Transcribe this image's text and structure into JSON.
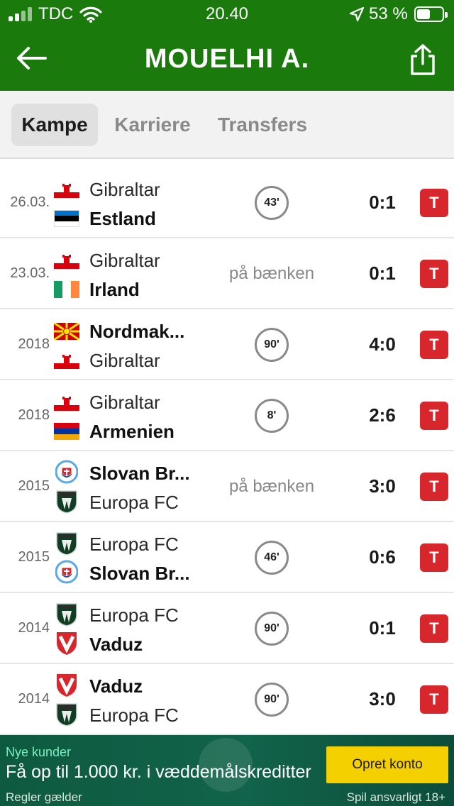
{
  "status_bar": {
    "carrier": "TDC",
    "time": "20.40",
    "battery": "53 %",
    "battery_level": 0.53,
    "icons": [
      "signal-icon",
      "wifi-icon",
      "location-arrow-icon",
      "battery-icon"
    ]
  },
  "header": {
    "title": "MOUELHI A.",
    "back_icon": "arrow-left-icon",
    "share_icon": "share-icon"
  },
  "tabs": [
    {
      "label": "Kampe",
      "active": true
    },
    {
      "label": "Karriere",
      "active": false
    },
    {
      "label": "Transfers",
      "active": false
    }
  ],
  "matches": [
    {
      "date": "26.03.",
      "home": "Gibraltar",
      "away": "Estland",
      "home_icon": "flag-gibraltar",
      "away_icon": "flag-estonia",
      "winner": "away",
      "minutes": "43'",
      "bench": "",
      "score": "0:1",
      "badge": "T"
    },
    {
      "date": "23.03.",
      "home": "Gibraltar",
      "away": "Irland",
      "home_icon": "flag-gibraltar",
      "away_icon": "flag-ireland",
      "winner": "away",
      "minutes": "",
      "bench": "på bænken",
      "score": "0:1",
      "badge": "T"
    },
    {
      "date": "2018",
      "home": "Nordmak...",
      "away": "Gibraltar",
      "home_icon": "flag-north-macedonia",
      "away_icon": "flag-gibraltar",
      "winner": "home",
      "minutes": "90'",
      "bench": "",
      "score": "4:0",
      "badge": "T"
    },
    {
      "date": "2018",
      "home": "Gibraltar",
      "away": "Armenien",
      "home_icon": "flag-gibraltar",
      "away_icon": "flag-armenia",
      "winner": "away",
      "minutes": "8'",
      "bench": "",
      "score": "2:6",
      "badge": "T"
    },
    {
      "date": "2015",
      "home": "Slovan Br...",
      "away": "Europa FC",
      "home_icon": "crest-slovan",
      "away_icon": "crest-europa",
      "winner": "home",
      "minutes": "",
      "bench": "på bænken",
      "score": "3:0",
      "badge": "T"
    },
    {
      "date": "2015",
      "home": "Europa FC",
      "away": "Slovan Br...",
      "home_icon": "crest-europa",
      "away_icon": "crest-slovan",
      "winner": "away",
      "minutes": "46'",
      "bench": "",
      "score": "0:6",
      "badge": "T"
    },
    {
      "date": "2014",
      "home": "Europa FC",
      "away": "Vaduz",
      "home_icon": "crest-europa",
      "away_icon": "crest-vaduz",
      "winner": "away",
      "minutes": "90'",
      "bench": "",
      "score": "0:1",
      "badge": "T"
    },
    {
      "date": "2014",
      "home": "Vaduz",
      "away": "Europa FC",
      "home_icon": "crest-vaduz",
      "away_icon": "crest-europa",
      "winner": "home",
      "minutes": "90'",
      "bench": "",
      "score": "3:0",
      "badge": "T"
    }
  ],
  "ad": {
    "kicker": "Nye kunder",
    "headline": "Få op til 1.000 kr. i væddemålskreditter",
    "cta": "Opret konto",
    "rules": "Regler gælder",
    "responsible": "Spil ansvarligt  18+"
  },
  "colors": {
    "header_green": "#1a7a0c",
    "badge_red": "#d8262d",
    "ad_cta_yellow": "#f5d000",
    "ad_green": "#0e5a40"
  }
}
